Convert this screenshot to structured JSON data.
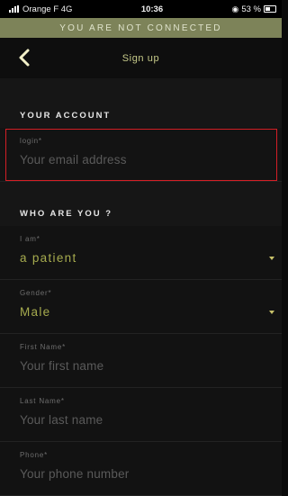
{
  "status_bar": {
    "carrier": "Orange F 4G",
    "time": "10:36",
    "battery": "53 %"
  },
  "banner": {
    "text": "YOU ARE NOT CONNECTED"
  },
  "navbar": {
    "title": "Sign up"
  },
  "sections": {
    "account": "YOUR ACCOUNT",
    "who": "WHO ARE YOU ?"
  },
  "fields": {
    "login": {
      "label": "login",
      "placeholder": "Your email address"
    },
    "iam": {
      "label": "I am",
      "value": "a patient"
    },
    "gender": {
      "label": "Gender",
      "value": "Male"
    },
    "first_name": {
      "label": "First Name",
      "placeholder": "Your first name"
    },
    "last_name": {
      "label": "Last Name",
      "placeholder": "Your last name"
    },
    "phone": {
      "label": "Phone",
      "placeholder": "Your phone number"
    }
  },
  "colors": {
    "banner": "#7d8359",
    "accent": "#a6ab4e",
    "highlight": "#d41f26"
  }
}
